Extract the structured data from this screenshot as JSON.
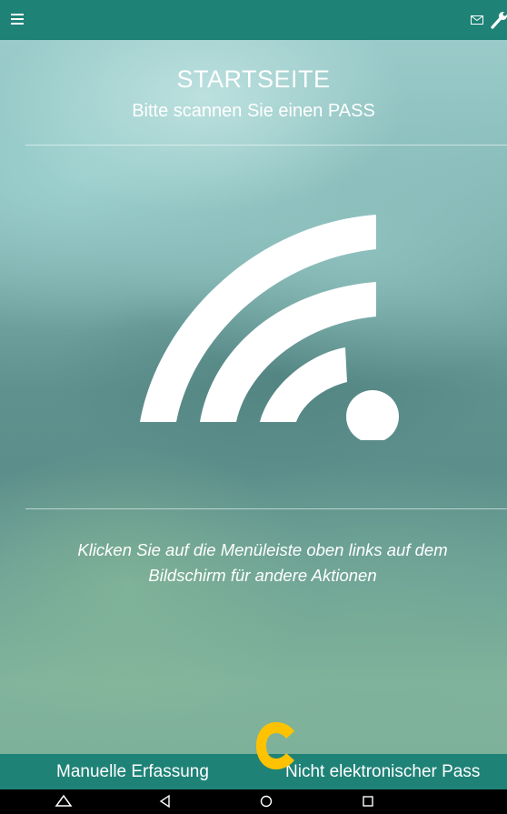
{
  "topbar": {
    "menu_icon": "hamburger-menu-icon",
    "mail_icon": "mail-icon",
    "settings_icon": "wrench-icon",
    "color": "#1f8277"
  },
  "header": {
    "title": "STARTSEITE",
    "subtitle": "Bitte scannen Sie einen PASS"
  },
  "main": {
    "scan_icon": "nfc-signal-icon",
    "hint_line1": "Klicken Sie auf die Menüleiste oben links auf dem",
    "hint_line2": "Bildschirm für andere Aktionen"
  },
  "actions": {
    "manual": "Manuelle Erfassung",
    "non_electronic": "Nicht elektronischer Pass",
    "badge_icon": "c-logo-icon",
    "badge_color": "#ffc200"
  },
  "navbar": {
    "icons": [
      "home-triangle-icon",
      "back-icon",
      "home-circle-icon",
      "recents-icon"
    ]
  }
}
